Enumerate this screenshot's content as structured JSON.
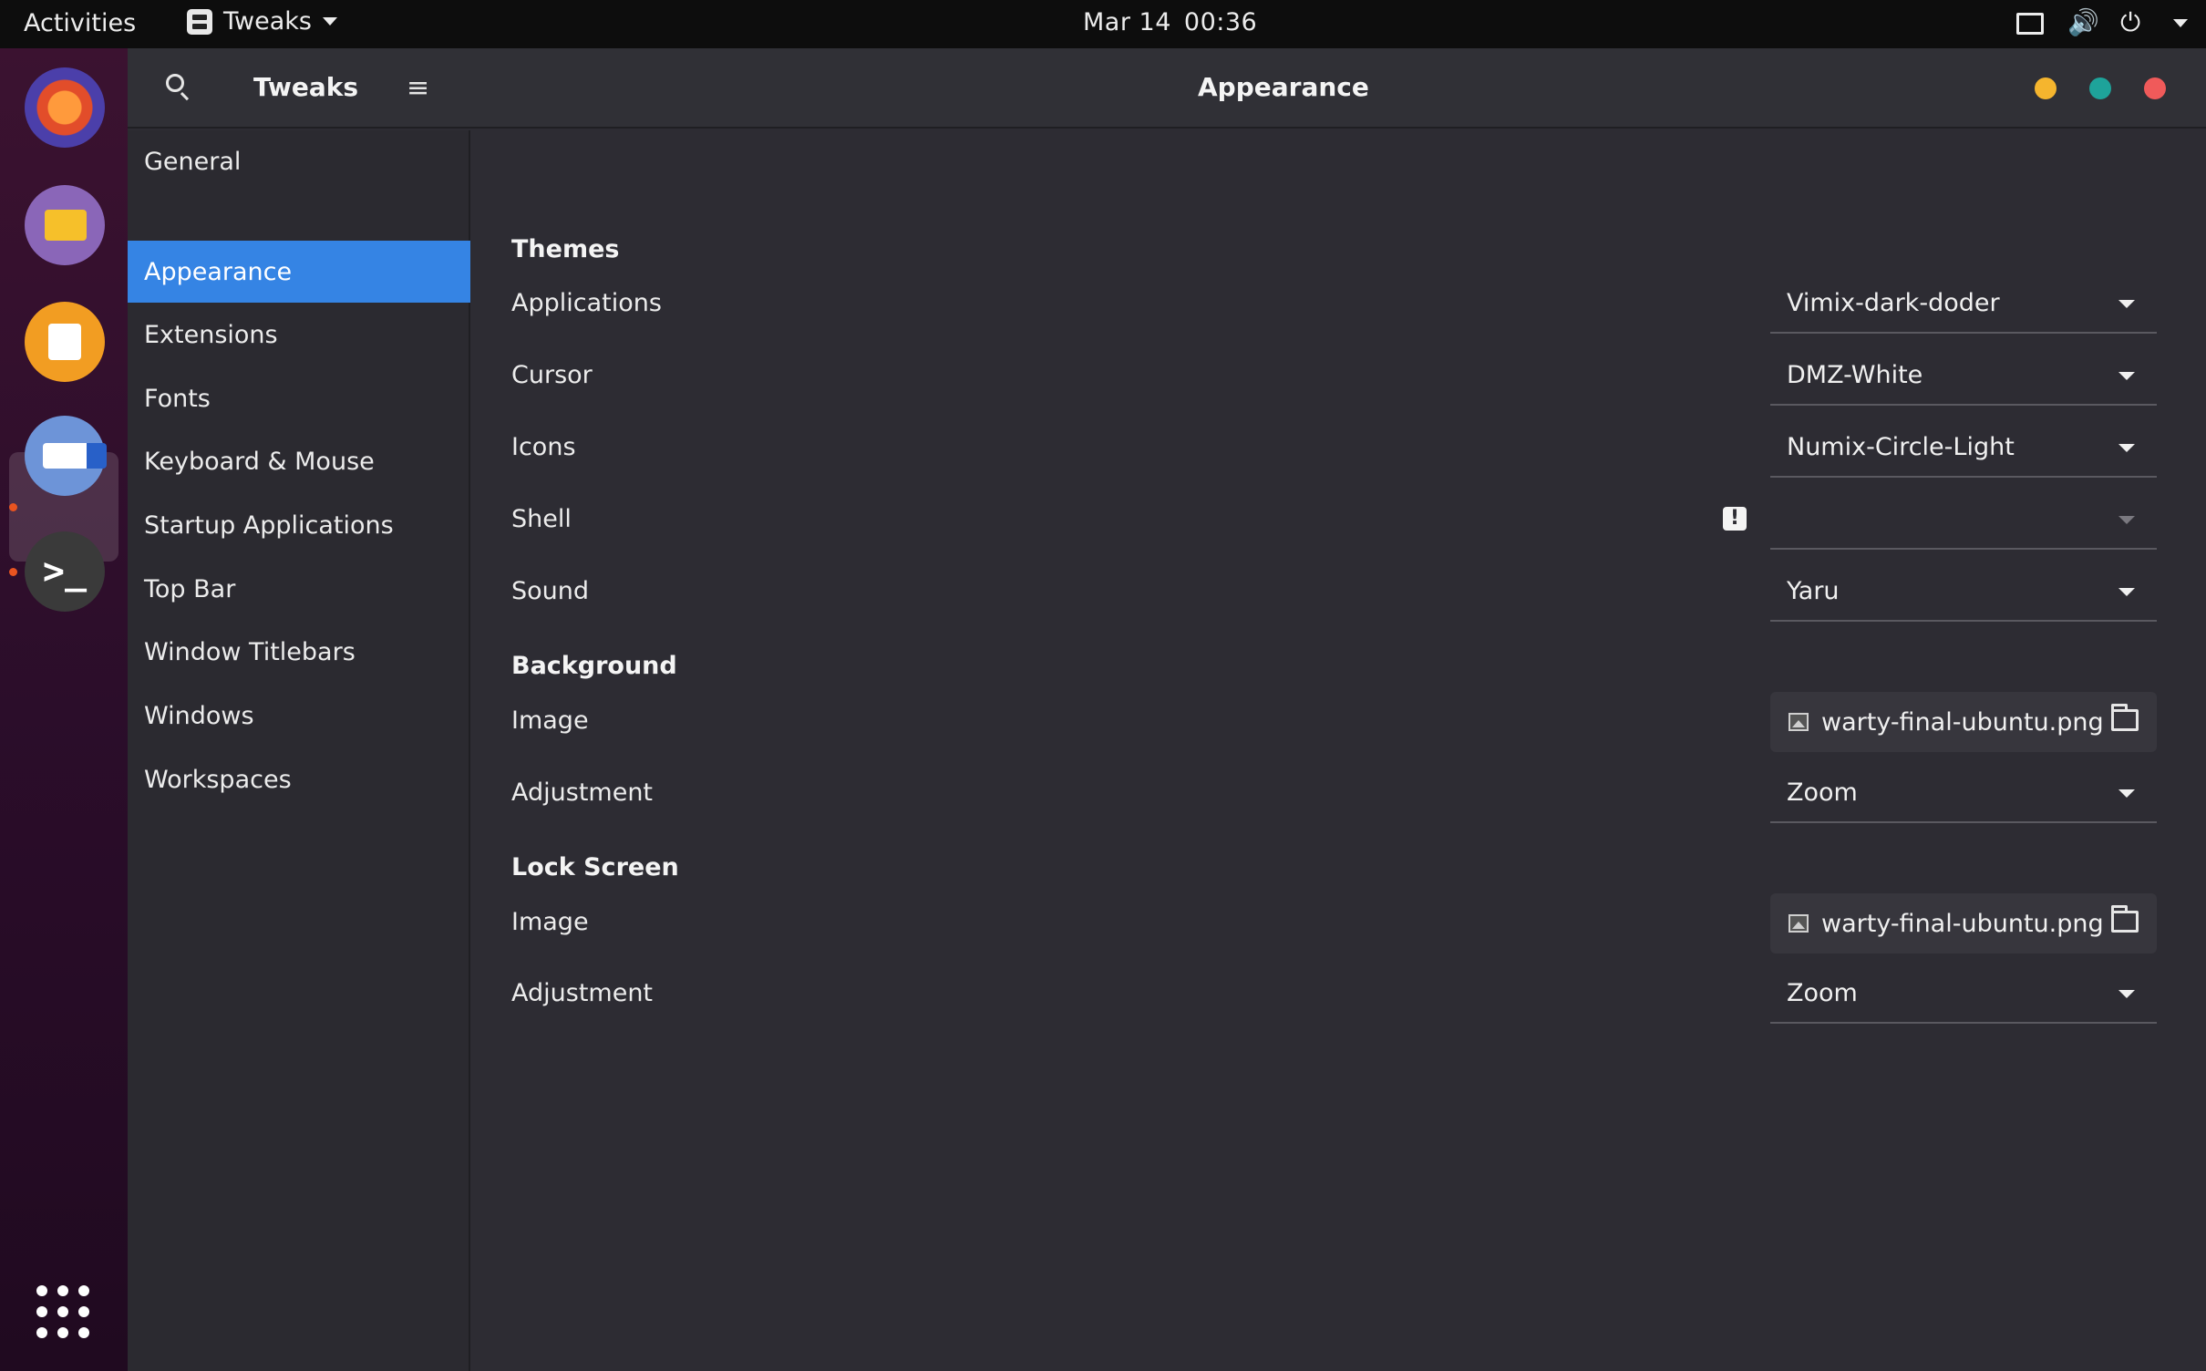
{
  "topbar": {
    "activities": "Activities",
    "app_menu": "Tweaks",
    "date": "Mar 14",
    "time": "00:36",
    "volume_glyph": "🔊",
    "power_glyph": "⏻"
  },
  "dock": {
    "items": [
      "firefox-icon",
      "files-icon",
      "software-center-icon",
      "tweaks-icon",
      "terminal-icon"
    ],
    "terminal_glyph": ">_"
  },
  "window": {
    "app_title": "Tweaks",
    "page_title": "Appearance",
    "menu_glyph": "≡",
    "colors": {
      "minimize": "#f5b52e",
      "maximize": "#1ea39a",
      "close": "#f05a5a",
      "accent": "#3584e4"
    }
  },
  "sidebar": {
    "items": [
      {
        "label": "General"
      },
      {
        "label": "Appearance"
      },
      {
        "label": "Extensions"
      },
      {
        "label": "Fonts"
      },
      {
        "label": "Keyboard & Mouse"
      },
      {
        "label": "Startup Applications"
      },
      {
        "label": "Top Bar"
      },
      {
        "label": "Window Titlebars"
      },
      {
        "label": "Windows"
      },
      {
        "label": "Workspaces"
      }
    ],
    "selected": "Appearance"
  },
  "content": {
    "themes": {
      "title": "Themes",
      "applications": {
        "label": "Applications",
        "value": "Vimix-dark-doder"
      },
      "cursor": {
        "label": "Cursor",
        "value": "DMZ-White"
      },
      "icons": {
        "label": "Icons",
        "value": "Numix-Circle-Light"
      },
      "shell": {
        "label": "Shell",
        "value": "",
        "warning": "!"
      },
      "sound": {
        "label": "Sound",
        "value": "Yaru"
      }
    },
    "background": {
      "title": "Background",
      "image": {
        "label": "Image",
        "value": "warty-final-ubuntu.png"
      },
      "adjustment": {
        "label": "Adjustment",
        "value": "Zoom"
      }
    },
    "lock_screen": {
      "title": "Lock Screen",
      "image": {
        "label": "Image",
        "value": "warty-final-ubuntu.png"
      },
      "adjustment": {
        "label": "Adjustment",
        "value": "Zoom"
      }
    }
  }
}
